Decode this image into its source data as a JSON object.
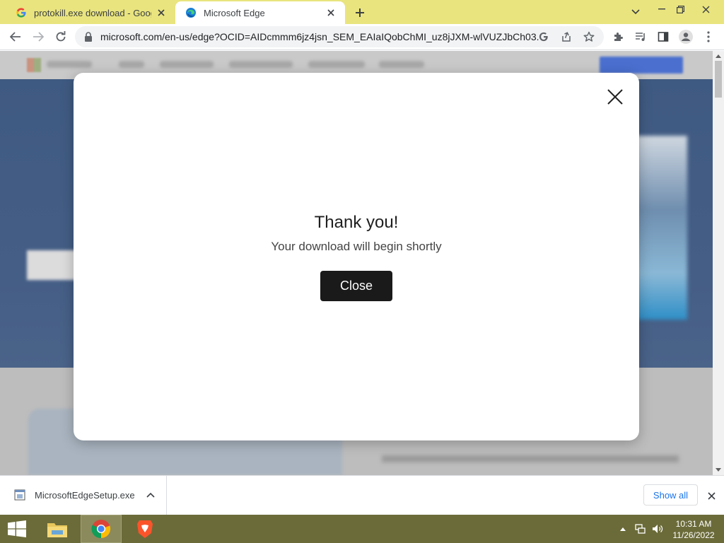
{
  "browser": {
    "tabs": [
      {
        "title": "protokill.exe download - Google",
        "active": false,
        "favicon": "google-g-icon"
      },
      {
        "title": "Microsoft Edge",
        "active": true,
        "favicon": "edge-logo-icon"
      }
    ],
    "url": "microsoft.com/en-us/edge?OCID=AIDcmmm6jz4jsn_SEM_EAIaIQobChMI_uz8jJXM-wlVUZJbCh03..."
  },
  "modal": {
    "heading": "Thank you!",
    "subtext": "Your download will begin shortly",
    "button_label": "Close"
  },
  "download_bar": {
    "filename": "MicrosoftEdgeSetup.exe",
    "show_all_label": "Show all"
  },
  "taskbar": {
    "time": "10:31 AM",
    "date": "11/26/2022"
  },
  "colors": {
    "tabstrip": "#e9e47e",
    "taskbar": "#6b6b3a",
    "modal_button": "#1a1a1a",
    "link_blue": "#1a73e8"
  }
}
